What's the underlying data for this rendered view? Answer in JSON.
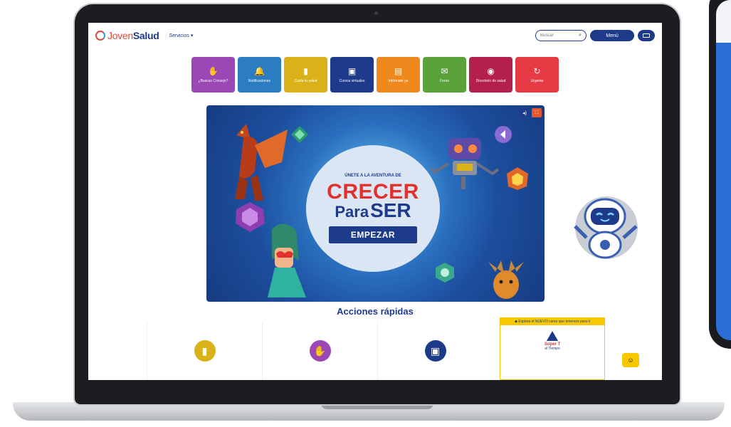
{
  "header": {
    "logo_prefix": "Joven",
    "logo_suffix": "Salud",
    "services_label": "Servicios ▾",
    "search_placeholder": "Buscar",
    "menu_label": "Menú"
  },
  "tiles": [
    {
      "label": "¿Buscas Consejo?",
      "color": "#9b47b5",
      "icon": "hand-icon"
    },
    {
      "label": "Notificaciones",
      "color": "#2b7cc1",
      "icon": "bell-icon"
    },
    {
      "label": "Cuida tu salud",
      "color": "#d9b21a",
      "icon": "traffic-light-icon"
    },
    {
      "label": "Cursos virtuales",
      "color": "#1e3a8a",
      "icon": "screen-icon"
    },
    {
      "label": "Infórmate ya",
      "color": "#ee8a1d",
      "icon": "document-icon"
    },
    {
      "label": "Foros",
      "color": "#5aa33a",
      "icon": "chat-icon"
    },
    {
      "label": "Directorio de salud",
      "color": "#b3204d",
      "icon": "pin-icon"
    },
    {
      "label": "Urgente",
      "color": "#e63b44",
      "icon": "alert-icon"
    }
  ],
  "banner": {
    "subtitle": "ÚNETE A LA AVENTURA DE",
    "title_crecer": "CRECER",
    "title_para": "Para",
    "title_ser": "SER",
    "start_label": "EMPEZAR"
  },
  "quick_actions": {
    "title": "Acciones rápidas",
    "items": [
      {
        "icon": "traffic-light-icon",
        "color": "#d9b21a"
      },
      {
        "icon": "hand-icon",
        "color": "#9b47b5"
      },
      {
        "icon": "screen-icon",
        "color": "#1e3a8a"
      }
    ],
    "promo_heading": "◆ Explora el NUEVO curso que tenemos para ti",
    "promo_title": "Súper T",
    "promo_sub": "al Tiempo"
  }
}
